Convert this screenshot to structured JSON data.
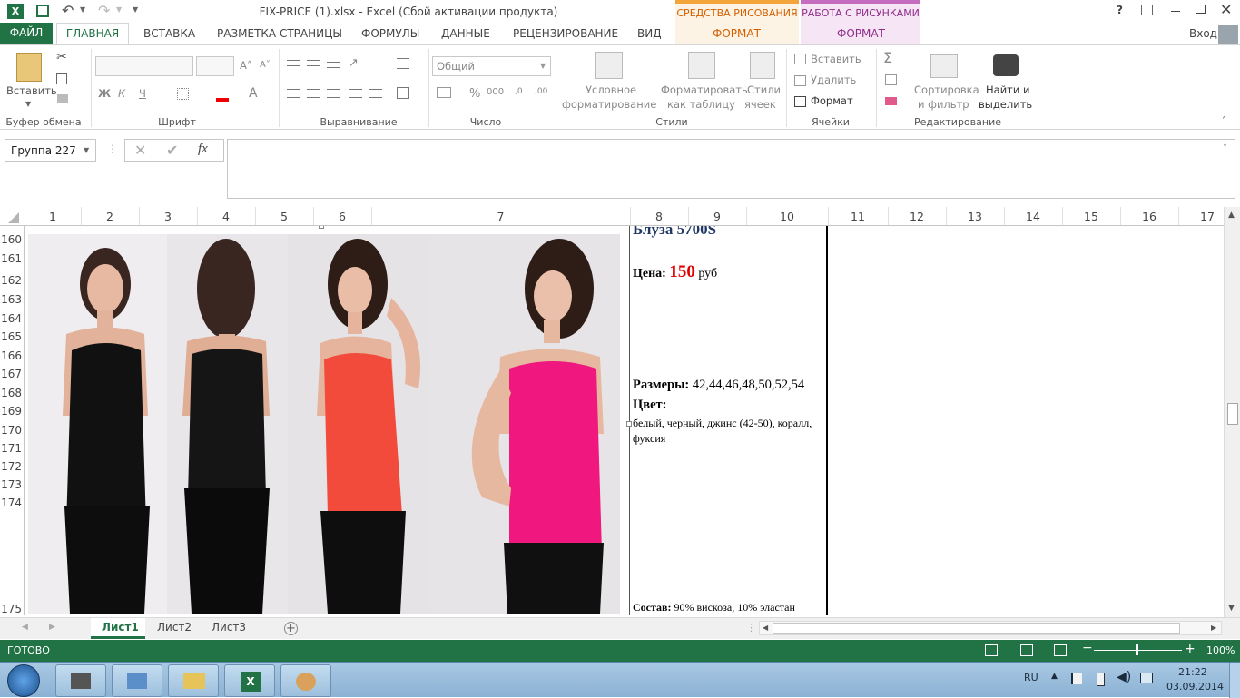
{
  "window": {
    "title": "FIX-PRICE (1).xlsx - Excel (Сбой активации продукта)",
    "help": "?",
    "signin": "Вход"
  },
  "context_tabs": {
    "drawing_tools": "СРЕДСТВА РИСОВАНИЯ",
    "picture_tools": "РАБОТА С РИСУНКАМИ",
    "format1": "ФОРМАТ",
    "format2": "ФОРМАТ"
  },
  "tabs": {
    "file": "ФАЙЛ",
    "home": "ГЛАВНАЯ",
    "insert": "ВСТАВКА",
    "layout": "РАЗМЕТКА СТРАНИЦЫ",
    "formulas": "ФОРМУЛЫ",
    "data": "ДАННЫЕ",
    "review": "РЕЦЕНЗИРОВАНИЕ",
    "view": "ВИД"
  },
  "ribbon": {
    "paste": "Вставить",
    "clipboard": "Буфер обмена",
    "font": "Шрифт",
    "alignment": "Выравнивание",
    "number": "Число",
    "number_format": "Общий",
    "styles": "Стили",
    "cond_format_1": "Условное",
    "cond_format_2": "форматирование",
    "format_table_1": "Форматировать",
    "format_table_2": "как таблицу",
    "cell_styles_1": "Стили",
    "cell_styles_2": "ячеек",
    "insert": "Вставить",
    "delete": "Удалить",
    "format": "Формат",
    "cells": "Ячейки",
    "sort_1": "Сортировка",
    "sort_2": "и фильтр",
    "find_1": "Найти и",
    "find_2": "выделить",
    "editing": "Редактирование",
    "bold": "Ж",
    "italic": "К",
    "underline": "Ч"
  },
  "formula_bar": {
    "name_box": "Группа 227",
    "fx": "fx",
    "value": ""
  },
  "columns": [
    "1",
    "2",
    "3",
    "4",
    "5",
    "6",
    "7",
    "8",
    "9",
    "10",
    "11",
    "12",
    "13",
    "14",
    "15",
    "16",
    "17"
  ],
  "rows": [
    "160",
    "161",
    "162",
    "163",
    "164",
    "165",
    "166",
    "167",
    "168",
    "169",
    "170",
    "171",
    "172",
    "173",
    "174",
    "175"
  ],
  "product": {
    "name": "Блуза 5700S",
    "price_label": "Цена:",
    "price_value": "150",
    "price_unit": "руб",
    "sizes_label": "Размеры:",
    "sizes_value": "42,44,46,48,50,52,54",
    "color_label": "Цвет:",
    "color_value_1": "белый, черный, джинс (42-50), коралл,",
    "color_value_2": "фуксия",
    "composition_label": "Состав:",
    "composition_value": "90% вискоза, 10% эластан"
  },
  "sheets": [
    "Лист1",
    "Лист2",
    "Лист3"
  ],
  "status": {
    "ready": "ГОТОВО",
    "zoom": "100%"
  },
  "taskbar": {
    "lang": "RU",
    "time": "21:22",
    "date": "03.09.2014"
  },
  "colors": {
    "accent": "#217346",
    "price": "#e00000",
    "photo_bg": "#e7e4e8"
  }
}
